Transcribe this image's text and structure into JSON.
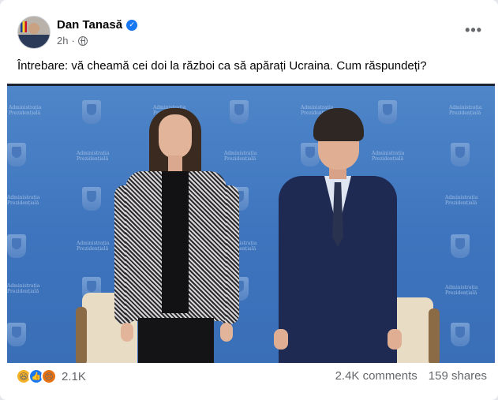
{
  "post": {
    "author": "Dan Tanasă",
    "time": "2h",
    "more_label": "•••",
    "text": "Întrebare: vă cheamă cei doi la război ca să apărați Ucraina. Cum răspundeți?",
    "verified_icon": "verified-badge-icon",
    "audience_icon": "globe-icon"
  },
  "photo": {
    "watermark_text": "Administrația Prezidențială"
  },
  "engagement": {
    "reaction_icons": [
      "haha-reaction-icon",
      "like-reaction-icon",
      "angry-reaction-icon"
    ],
    "reaction_count": "2.1K",
    "comments": "2.4K comments",
    "shares": "159 shares"
  },
  "colors": {
    "accent": "#1877f2",
    "backdrop": "#3d74bd",
    "secondary_text": "#65676b"
  }
}
